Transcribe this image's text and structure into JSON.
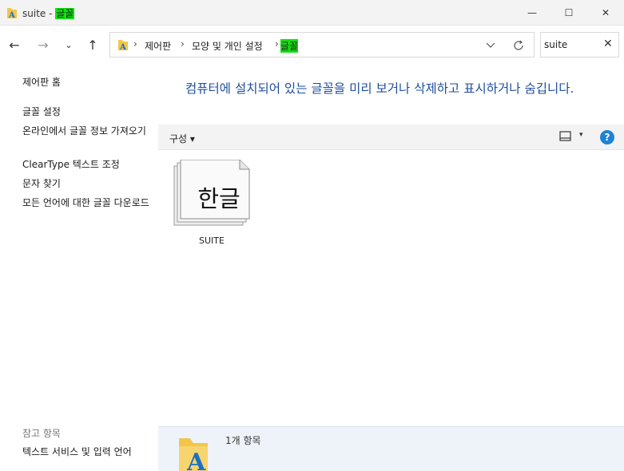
{
  "window": {
    "title_prefix": "suite - ",
    "title_highlight": "글꼴",
    "minimize_glyph": "—",
    "maximize_glyph": "☐",
    "close_glyph": "✕"
  },
  "nav": {
    "back_glyph": "←",
    "forward_glyph": "→",
    "recent_glyph": "⌄",
    "up_glyph": "↑"
  },
  "address": {
    "breadcrumb": [
      "제어판",
      "모양 및 개인 설정",
      "글꼴"
    ],
    "separator": "›"
  },
  "search": {
    "value": "suite",
    "clear_glyph": "✕"
  },
  "sidebar": {
    "items": [
      {
        "label": "제어판 홈"
      },
      {
        "label": "글꼴 설정"
      },
      {
        "label": "온라인에서 글꼴 정보 가져오기"
      },
      {
        "label": "ClearType 텍스트 조정"
      },
      {
        "label": "문자 찾기"
      },
      {
        "label": "모든 언어에 대한 글꼴 다운로드"
      }
    ],
    "see_also_heading": "참고 항목",
    "see_also_items": [
      {
        "label": "텍스트 서비스 및 입력 언어"
      }
    ]
  },
  "main": {
    "heading": "컴퓨터에 설치되어 있는 글꼴을 미리 보거나 삭제하고 표시하거나 숨깁니다.",
    "toolbar": {
      "organize_label": "구성 ▾",
      "view_dropdown_glyph": "▾",
      "help_glyph": "?"
    },
    "fonts": [
      {
        "preview_text": "한글",
        "name": "SUITE"
      }
    ]
  },
  "details": {
    "count_label": "1개 항목"
  },
  "colors": {
    "highlight": "#11e011",
    "heading_blue": "#1e4e9c",
    "help_blue": "#1e82d6",
    "folder_yellow": "#f3c64a",
    "font_a_blue": "#1d6fc4"
  },
  "icons": {
    "app": "fonts-folder-icon",
    "view": "view-layout-icon",
    "help": "help-icon",
    "refresh": "refresh-icon"
  }
}
